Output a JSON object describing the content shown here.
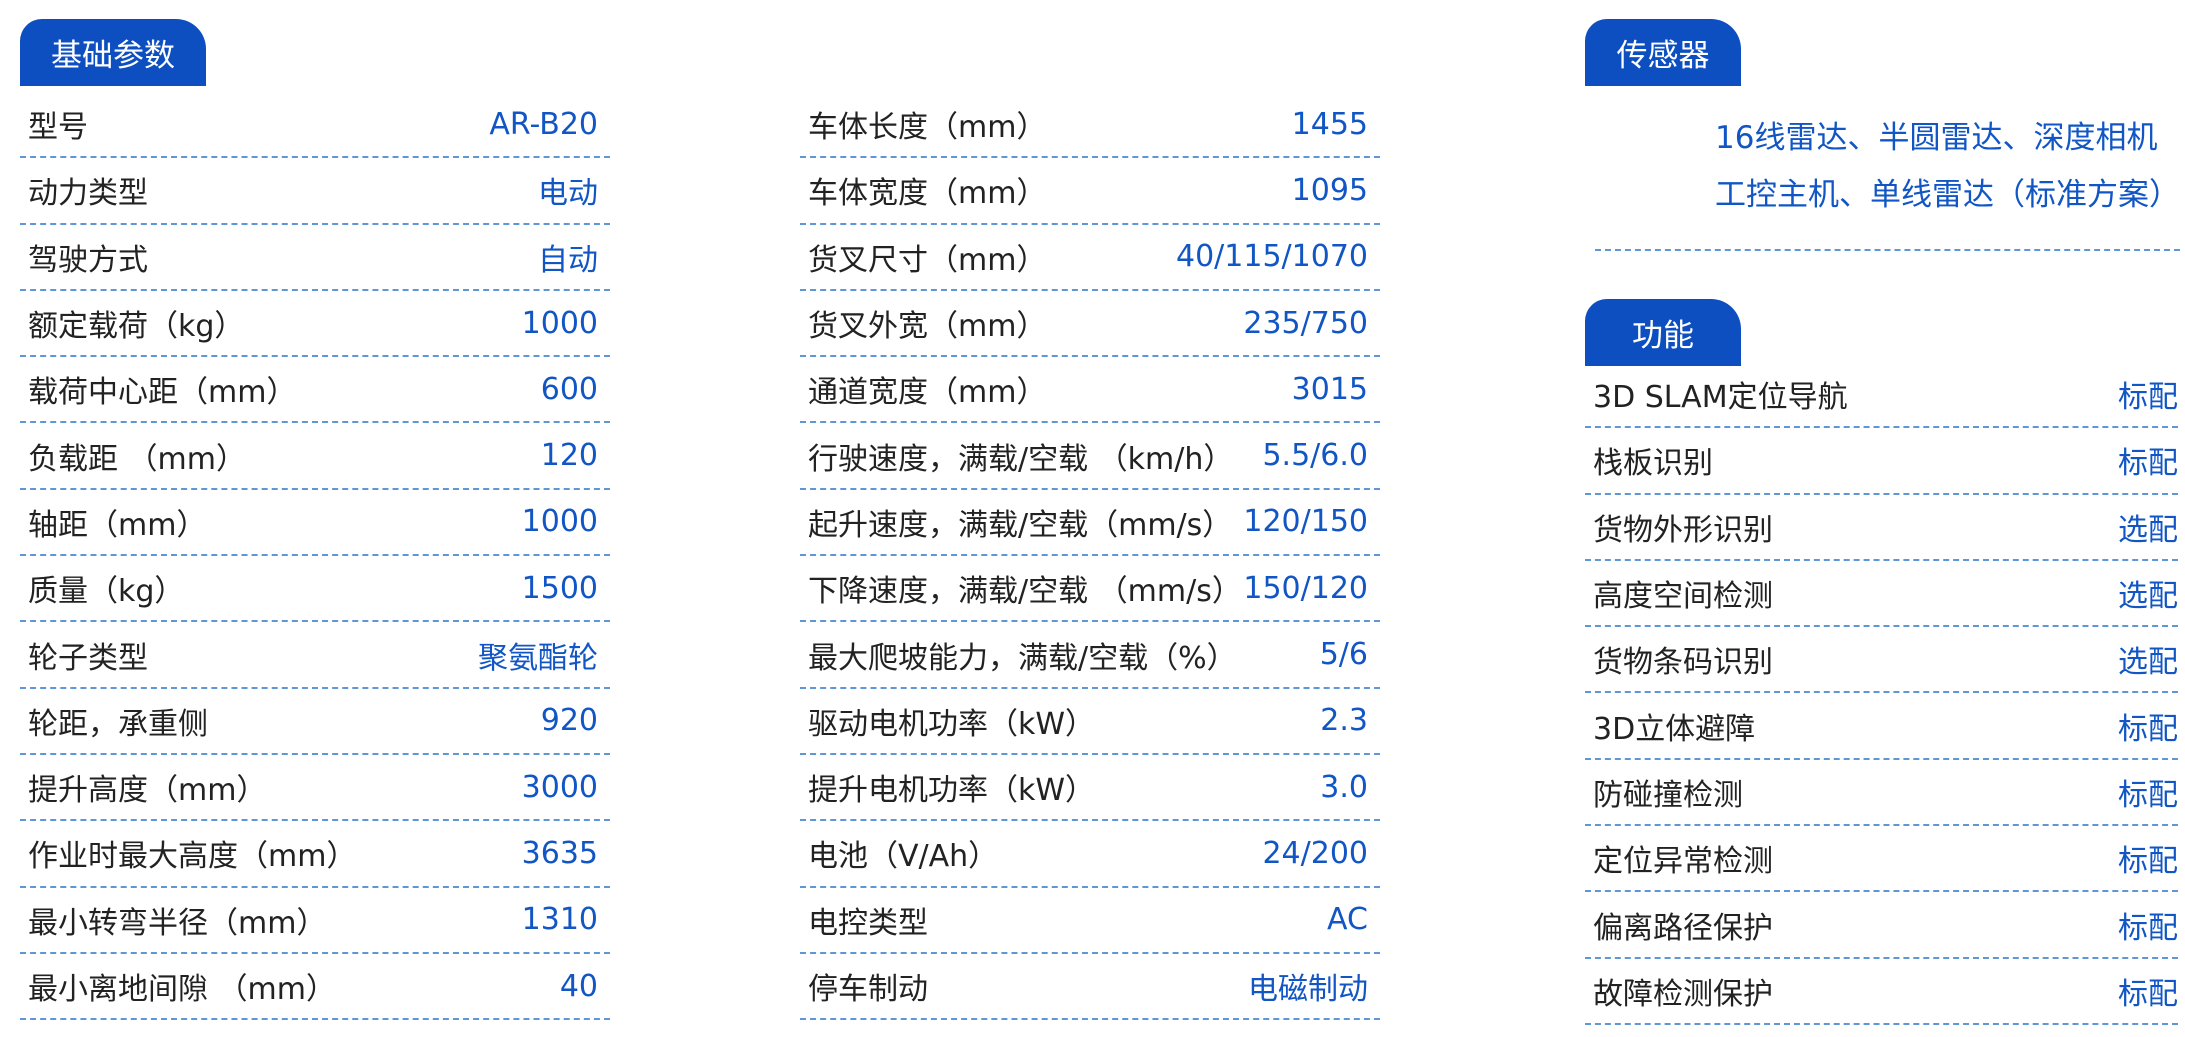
{
  "tabs": {
    "basic": "基础参数",
    "sensor": "传感器",
    "function": "功能"
  },
  "basic_params": [
    {
      "label": "型号",
      "value": "AR-B20"
    },
    {
      "label": "动力类型",
      "value": "电动"
    },
    {
      "label": "驾驶方式",
      "value": "自动"
    },
    {
      "label": "额定载荷（kg）",
      "value": "1000"
    },
    {
      "label": "载荷中心距（mm）",
      "value": "600"
    },
    {
      "label": "负载距 （mm）",
      "value": "120"
    },
    {
      "label": "轴距（mm）",
      "value": "1000"
    },
    {
      "label": "质量（kg）",
      "value": "1500"
    },
    {
      "label": "轮子类型",
      "value": "聚氨酯轮"
    },
    {
      "label": "轮距，承重侧",
      "value": "920"
    },
    {
      "label": "提升高度（mm）",
      "value": "3000"
    },
    {
      "label": "作业时最大高度（mm）",
      "value": "3635"
    },
    {
      "label": "最小转弯半径（mm）",
      "value": "1310"
    },
    {
      "label": "最小离地间隙 （mm）",
      "value": "40"
    }
  ],
  "dimension_params": [
    {
      "label": "车体长度（mm）",
      "value": "1455"
    },
    {
      "label": "车体宽度（mm）",
      "value": "1095"
    },
    {
      "label": "货叉尺寸（mm）",
      "value": "40/115/1070"
    },
    {
      "label": "货叉外宽（mm）",
      "value": "235/750"
    },
    {
      "label": "通道宽度（mm）",
      "value": "3015"
    },
    {
      "label": "行驶速度，满载/空载 （km/h）",
      "value": "5.5/6.0"
    },
    {
      "label": "起升速度，满载/空载（mm/s）",
      "value": "120/150"
    },
    {
      "label": "下降速度，满载/空载 （mm/s）",
      "value": "150/120"
    },
    {
      "label": "最大爬坡能力，满载/空载（%）",
      "value": "5/6"
    },
    {
      "label": "驱动电机功率（kW）",
      "value": "2.3"
    },
    {
      "label": "提升电机功率（kW）",
      "value": "3.0"
    },
    {
      "label": "电池（V/Ah）",
      "value": "24/200"
    },
    {
      "label": "电控类型",
      "value": "AC"
    },
    {
      "label": "停车制动",
      "value": "电磁制动"
    }
  ],
  "sensor": {
    "line1": "16线雷达、半圆雷达、深度相机",
    "line2": "工控主机、单线雷达（标准方案）"
  },
  "functions": [
    {
      "label": "3D SLAM定位导航",
      "value": "标配"
    },
    {
      "label": "栈板识别",
      "value": "标配"
    },
    {
      "label": "货物外形识别",
      "value": "选配"
    },
    {
      "label": "高度空间检测",
      "value": "选配"
    },
    {
      "label": "货物条码识别",
      "value": "选配"
    },
    {
      "label": "3D立体避障",
      "value": "标配"
    },
    {
      "label": "防碰撞检测",
      "value": "标配"
    },
    {
      "label": "定位异常检测",
      "value": "标配"
    },
    {
      "label": "偏离路径保护",
      "value": "标配"
    },
    {
      "label": "故障检测保护",
      "value": "标配"
    }
  ],
  "colors": {
    "accent": "#0d4fc0",
    "value_text": "#1156c4",
    "divider": "#5f96d8"
  }
}
